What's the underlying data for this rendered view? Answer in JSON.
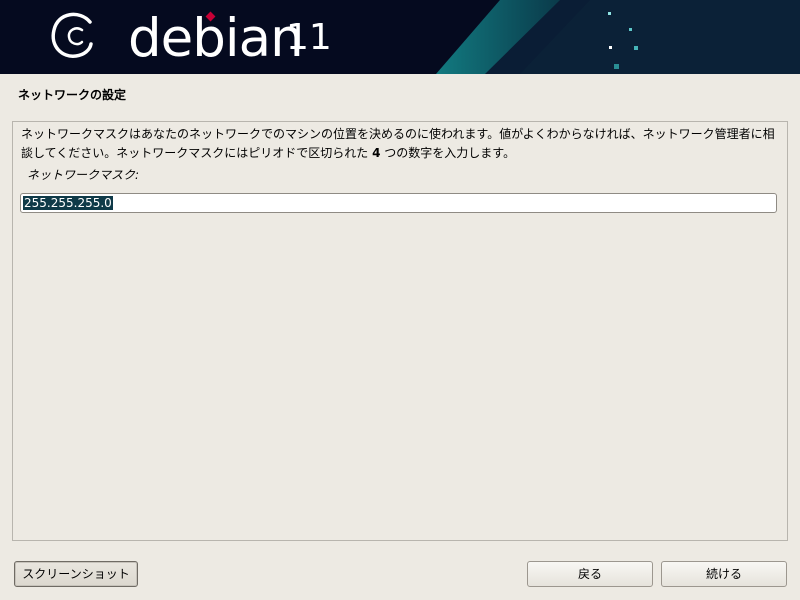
{
  "banner": {
    "logo_text": "debian",
    "version": "11"
  },
  "page": {
    "title": "ネットワークの設定"
  },
  "content": {
    "description_before_bold": "ネットワークマスクはあなたのネットワークでのマシンの位置を決めるのに使われます。値がよくわからなければ、ネットワーク管理者に相談してください。ネットワークマスクにはピリオドで区切られた ",
    "description_bold": "4",
    "description_after_bold": " つの数字を入力します。",
    "field_label": "ネットワークマスク:",
    "field_value": "255.255.255.0"
  },
  "buttons": {
    "screenshot": "スクリーンショット",
    "back": "戻る",
    "continue": "続ける"
  },
  "colors": {
    "banner_bg": "#050a1f",
    "accent_teal": "#1a8b91",
    "logo_swirl_red": "#c70036",
    "window_bg": "#edeae3",
    "selection_bg": "#0f3a48"
  }
}
